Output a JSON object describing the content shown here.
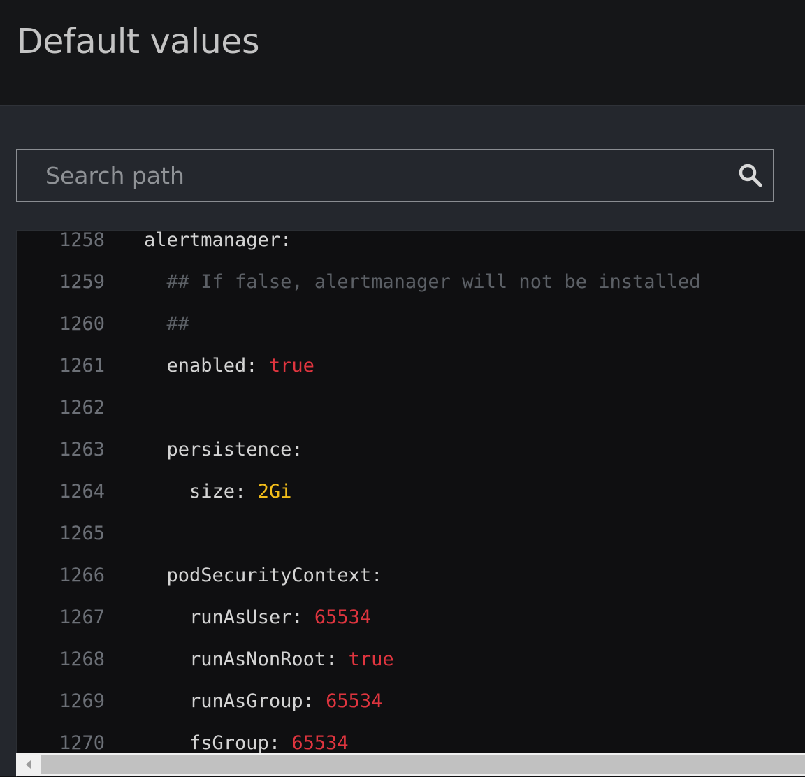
{
  "header": {
    "title": "Default values"
  },
  "search": {
    "placeholder": "Search path",
    "icon": "search-icon"
  },
  "colors": {
    "key": "#d4d4d4",
    "comment": "#5c6066",
    "number_bool": "#e0353f",
    "string": "#f2bd1a",
    "line_number": "#6c7077"
  },
  "code": {
    "lines": [
      {
        "number": "1258",
        "indent": "",
        "key": "alertmanager:",
        "value": "",
        "comment": ""
      },
      {
        "number": "1259",
        "indent": "  ",
        "key": "",
        "value": "",
        "comment": "## If false, alertmanager will not be installed"
      },
      {
        "number": "1260",
        "indent": "  ",
        "key": "",
        "value": "",
        "comment": "##"
      },
      {
        "number": "1261",
        "indent": "  ",
        "key": "enabled: ",
        "value": "true",
        "comment": ""
      },
      {
        "number": "1262",
        "indent": "",
        "key": "",
        "value": "",
        "comment": ""
      },
      {
        "number": "1263",
        "indent": "  ",
        "key": "persistence:",
        "value": "",
        "comment": ""
      },
      {
        "number": "1264",
        "indent": "    ",
        "key": "size: ",
        "value": "2Gi",
        "comment": ""
      },
      {
        "number": "1265",
        "indent": "",
        "key": "",
        "value": "",
        "comment": ""
      },
      {
        "number": "1266",
        "indent": "  ",
        "key": "podSecurityContext:",
        "value": "",
        "comment": ""
      },
      {
        "number": "1267",
        "indent": "    ",
        "key": "runAsUser: ",
        "value": "65534",
        "comment": ""
      },
      {
        "number": "1268",
        "indent": "    ",
        "key": "runAsNonRoot: ",
        "value": "true",
        "comment": ""
      },
      {
        "number": "1269",
        "indent": "    ",
        "key": "runAsGroup: ",
        "value": "65534",
        "comment": ""
      },
      {
        "number": "1270",
        "indent": "    ",
        "key": "fsGroup: ",
        "value": "65534",
        "comment": ""
      }
    ]
  }
}
